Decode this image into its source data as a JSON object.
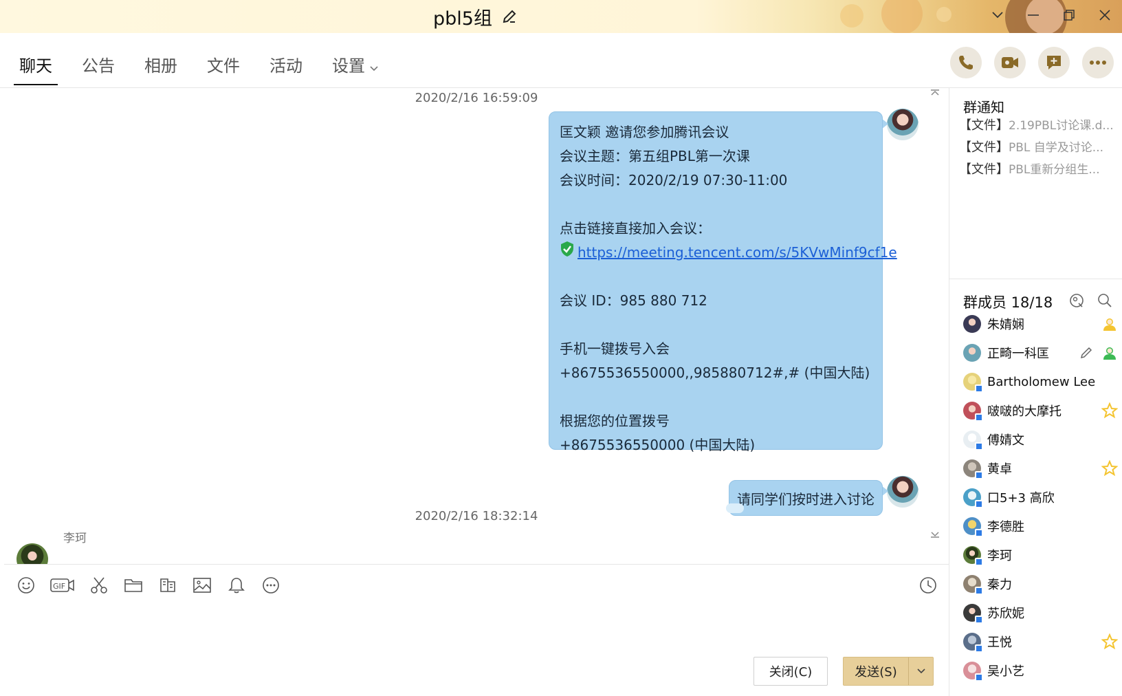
{
  "window": {
    "title": "pbl5组"
  },
  "tabs": [
    {
      "label": "聊天"
    },
    {
      "label": "公告"
    },
    {
      "label": "相册"
    },
    {
      "label": "文件"
    },
    {
      "label": "活动"
    },
    {
      "label": "设置"
    }
  ],
  "chat": {
    "timestamp_1": "2020/2/16 16:59:09",
    "meeting": {
      "lines": [
        "匡文颖 邀请您参加腾讯会议",
        "会议主题：第五组PBL第一次课",
        "会议时间：2020/2/19 07:30-11:00",
        "",
        "点击链接直接加入会议：",
        "https://meeting.tencent.com/s/5KVwMinf9cf1e",
        "",
        "会议 ID：985 880 712",
        "",
        "手机一键拨号入会",
        "+8675536550000,,985880712#,# (中国大陆)",
        "",
        "根据您的位置拨号",
        "+8675536550000 (中国大陆)"
      ]
    },
    "message_2": "请同学们按时进入讨论",
    "timestamp_2": "2020/2/16 18:32:14",
    "next_sender": "李珂"
  },
  "input": {
    "close_label": "关闭(C)",
    "send_label": "发送(S)"
  },
  "notice": {
    "title": "群通知",
    "items": [
      {
        "tag": "【文件】",
        "name": "2.19PBL讨论课.d..."
      },
      {
        "tag": "【文件】",
        "name": "PBL 自学及讨论..."
      },
      {
        "tag": "【文件】",
        "name": "PBL重新分组生..."
      }
    ]
  },
  "members": {
    "title": "群成员 18/18",
    "list": [
      {
        "name": "朱婧娴",
        "role": "owner"
      },
      {
        "name": "正畸一科匡",
        "role": "admin-editable"
      },
      {
        "name": "Bartholomew Lee",
        "role": ""
      },
      {
        "name": "啵啵的大摩托",
        "role": "star"
      },
      {
        "name": "傅婧文",
        "role": ""
      },
      {
        "name": "黄卓",
        "role": "star"
      },
      {
        "name": "口5+3 高欣",
        "role": ""
      },
      {
        "name": "李德胜",
        "role": ""
      },
      {
        "name": "李珂",
        "role": ""
      },
      {
        "name": "秦力",
        "role": ""
      },
      {
        "name": "苏欣妮",
        "role": ""
      },
      {
        "name": "王悦",
        "role": "star"
      },
      {
        "name": "吴小艺",
        "role": ""
      }
    ]
  },
  "colors": {
    "bubble": "#a9d3f0",
    "send_button": "#e7cf9a",
    "star": "#f4c430",
    "link": "#1b5fd6"
  }
}
